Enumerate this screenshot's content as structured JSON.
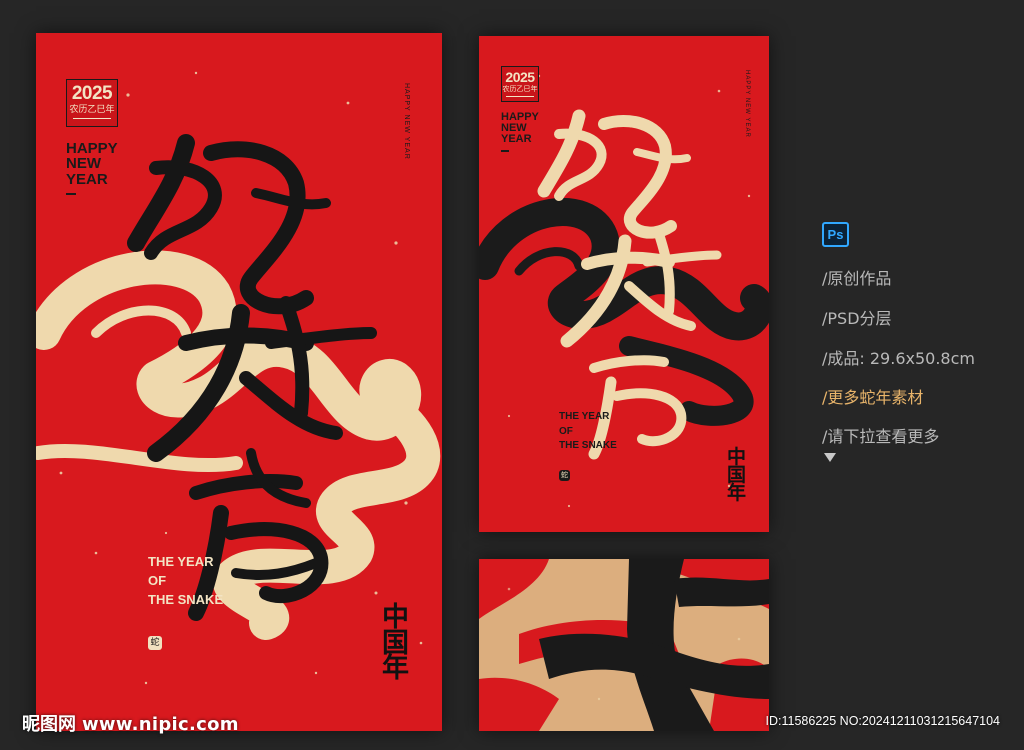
{
  "badge": {
    "year": "2025",
    "lunar": "农历乙巳年"
  },
  "greeting": {
    "line1": "HAPPY",
    "line2": "NEW",
    "line3": "YEAR"
  },
  "vertical_tag": "HAPPY NEW YEAR",
  "headline": "蛇年大吉",
  "year_of_snake": {
    "line1": "THE YEAR",
    "line2": "OF",
    "line3": "THE SNAKE"
  },
  "china_year": {
    "c1": "中",
    "c2": "国",
    "c3": "年"
  },
  "seal_glyph": "蛇",
  "info": {
    "app_icon": "Ps",
    "line1": "/原创作品",
    "line2": "/PSD分层",
    "line3": "/成品: 29.6x50.8cm",
    "line4": "/更多蛇年素材",
    "line5": "/请下拉查看更多"
  },
  "watermark": {
    "brand": "昵图网",
    "url": "www.nipic.com",
    "id_text": "ID:11586225 NO:20241211031215647104"
  },
  "colors": {
    "background": "#262626",
    "poster_red": "#d8191e",
    "cream": "#efd9ad",
    "ink": "#1a1a1a",
    "accent_link": "#e8b46a",
    "ps_blue": "#31a8ff"
  }
}
